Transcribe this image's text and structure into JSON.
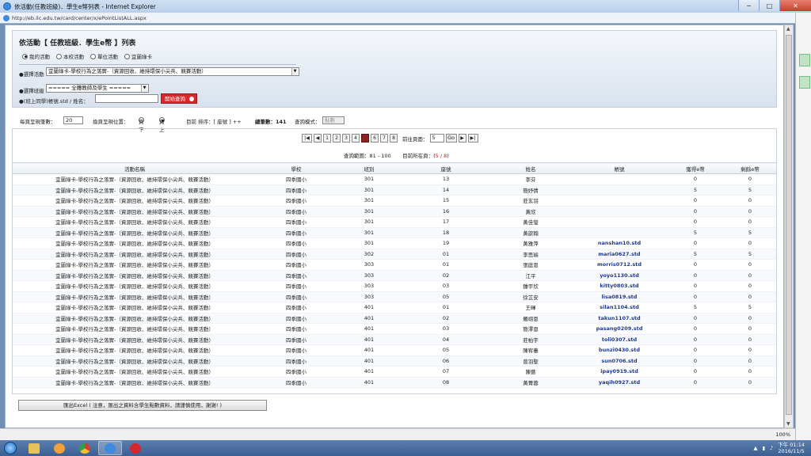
{
  "window": {
    "title": "依活動(任教班級)．學生e幣列表 - Internet Explorer",
    "url": "http://eb.ilc.edu.tw/card/center/x/ePointListALL.aspx",
    "min": "─",
    "max": "□",
    "close": "✕"
  },
  "panel": {
    "title": "依活動【 任教班級．學生e幣 】列表",
    "radios": [
      {
        "label": "我的活動",
        "checked": true
      },
      {
        "label": "本校活動",
        "checked": false
      },
      {
        "label": "單位活動",
        "checked": false
      },
      {
        "label": "宜蘭綠卡",
        "checked": false
      }
    ],
    "activity_label": "●選擇活動",
    "activity_value": "宜蘭綠卡-學校行為之落實-（資源回收、維持環保小尖兵、競賽活動）",
    "class_label": "●選擇班級",
    "class_value": "===== 全體教師及學生 =====",
    "query_label": "●(班上同學)帳號.std / 姓名：",
    "query_value": "",
    "search_button": "開始查詢"
  },
  "options": {
    "per_page_label": "每頁呈現筆數：",
    "per_page_value": "20",
    "position_label": "換頁呈現位置：",
    "position_options": [
      {
        "label": "頁下",
        "checked": false
      },
      {
        "label": "頁上",
        "checked": true
      }
    ],
    "sort_text": "目前 排序：[ 座號 ] ++",
    "total_text": "總筆數：141",
    "mode_label": "查詢模式：",
    "mode_value": "點數"
  },
  "pager": {
    "first": "|◀",
    "prev": "◀",
    "pages": [
      "1",
      "2",
      "3",
      "4",
      "5",
      "6",
      "7",
      "8"
    ],
    "current": "5",
    "next": "▶",
    "last": "▶|",
    "goto_label": "前往頁面：",
    "goto_value": "5",
    "go_button": "Go"
  },
  "range": {
    "range_text": "查詢範圍：81 - 100",
    "page_label": "目前所在頁：(",
    "page_value": "5 / 8",
    "page_close": ")"
  },
  "table": {
    "headers": [
      "活動名稱",
      "學校",
      "班別",
      "座號",
      "姓名",
      "帳號",
      "獲得e幣",
      "剩餘e幣"
    ],
    "rows": [
      [
        "宜蘭綠卡-學校行為之落實-（資源回收、維持環保小尖兵、競賽活動）",
        "四季國小",
        "301",
        "13",
        "李芬",
        "",
        "0",
        "0"
      ],
      [
        "宜蘭綠卡-學校行為之落實-（資源回收、維持環保小尖兵、競賽活動）",
        "四季國小",
        "301",
        "14",
        "簡妤倩",
        "",
        "5",
        "5"
      ],
      [
        "宜蘭綠卡-學校行為之落實-（資源回收、維持環保小尖兵、競賽活動）",
        "四季國小",
        "301",
        "15",
        "莊玄羽",
        "",
        "0",
        "0"
      ],
      [
        "宜蘭綠卡-學校行為之落實-（資源回收、維持環保小尖兵、競賽活動）",
        "四季國小",
        "301",
        "16",
        "黃欣",
        "",
        "0",
        "0"
      ],
      [
        "宜蘭綠卡-學校行為之落實-（資源回收、維持環保小尖兵、競賽活動）",
        "四季國小",
        "301",
        "17",
        "黃佳瑩",
        "",
        "0",
        "0"
      ],
      [
        "宜蘭綠卡-學校行為之落實-（資源回收、維持環保小尖兵、競賽活動）",
        "四季國小",
        "301",
        "18",
        "黃歆翰",
        "",
        "5",
        "5"
      ],
      [
        "宜蘭綠卡-學校行為之落實-（資源回收、維持環保小尖兵、競賽活動）",
        "四季國小",
        "301",
        "19",
        "黃雅萍",
        "nanshan10.std",
        "0",
        "0"
      ],
      [
        "宜蘭綠卡-學校行為之落實-（資源回收、維持環保小尖兵、競賽活動）",
        "四季國小",
        "302",
        "01",
        "李思瑜",
        "maria0627.std",
        "5",
        "5"
      ],
      [
        "宜蘭綠卡-學校行為之落實-（資源回收、維持環保小尖兵、競賽活動）",
        "四季國小",
        "303",
        "01",
        "張庭恩",
        "morris0712.std",
        "0",
        "0"
      ],
      [
        "宜蘭綠卡-學校行為之落實-（資源回收、維持環保小尖兵、競賽活動）",
        "四季國小",
        "303",
        "02",
        "江平",
        "yoyo1130.std",
        "0",
        "0"
      ],
      [
        "宜蘭綠卡-學校行為之落實-（資源回收、維持環保小尖兵、競賽活動）",
        "四季國小",
        "303",
        "03",
        "鍾宇欣",
        "kitty0803.std",
        "0",
        "0"
      ],
      [
        "宜蘭綠卡-學校行為之落實-（資源回收、維持環保小尖兵、競賽活動）",
        "四季國小",
        "303",
        "05",
        "徐芷安",
        "lisa0819.std",
        "0",
        "0"
      ],
      [
        "宜蘭綠卡-學校行為之落實-（資源回收、維持環保小尖兵、競賽活動）",
        "四季國小",
        "401",
        "01",
        "王暉",
        "silan1104.std",
        "5",
        "5"
      ],
      [
        "宜蘭綠卡-學校行為之落實-（資源回收、維持環保小尖兵、競賽活動）",
        "四季國小",
        "401",
        "02",
        "羅翊恩",
        "takun1107.std",
        "0",
        "0"
      ],
      [
        "宜蘭綠卡-學校行為之落實-（資源回收、維持環保小尖兵、競賽活動）",
        "四季國小",
        "401",
        "03",
        "簡澤恩",
        "pasang0209.std",
        "0",
        "0"
      ],
      [
        "宜蘭綠卡-學校行為之落實-（資源回收、維持環保小尖兵、競賽活動）",
        "四季國小",
        "401",
        "04",
        "莊柏宇",
        "toli0307.std",
        "0",
        "0"
      ],
      [
        "宜蘭綠卡-學校行為之落實-（資源回收、維持環保小尖兵、競賽活動）",
        "四季國小",
        "401",
        "05",
        "陳宥蓁",
        "bunzi0430.std",
        "0",
        "0"
      ],
      [
        "宜蘭綠卡-學校行為之落實-（資源回收、維持環保小尖兵、競賽活動）",
        "四季國小",
        "401",
        "06",
        "曾羽聖",
        "sun0706.std",
        "0",
        "0"
      ],
      [
        "宜蘭綠卡-學校行為之落實-（資源回收、維持環保小尖兵、競賽活動）",
        "四季國小",
        "401",
        "07",
        "陳藝",
        "ipay0919.std",
        "0",
        "0"
      ],
      [
        "宜蘭綠卡-學校行為之落實-（資源回收、維持環保小尖兵、競賽活動）",
        "四季國小",
        "401",
        "08",
        "黃菁蓉",
        "yaqih0927.std",
        "0",
        "0"
      ]
    ]
  },
  "export_button": "匯出Excel ( 注意，匯出之資料含學生點數資料，請謹慎使用，謝謝! )",
  "statusbar": {
    "zoom": "100%"
  },
  "taskbar": {
    "time": "下午 01:14",
    "date": "2016/11/5"
  }
}
